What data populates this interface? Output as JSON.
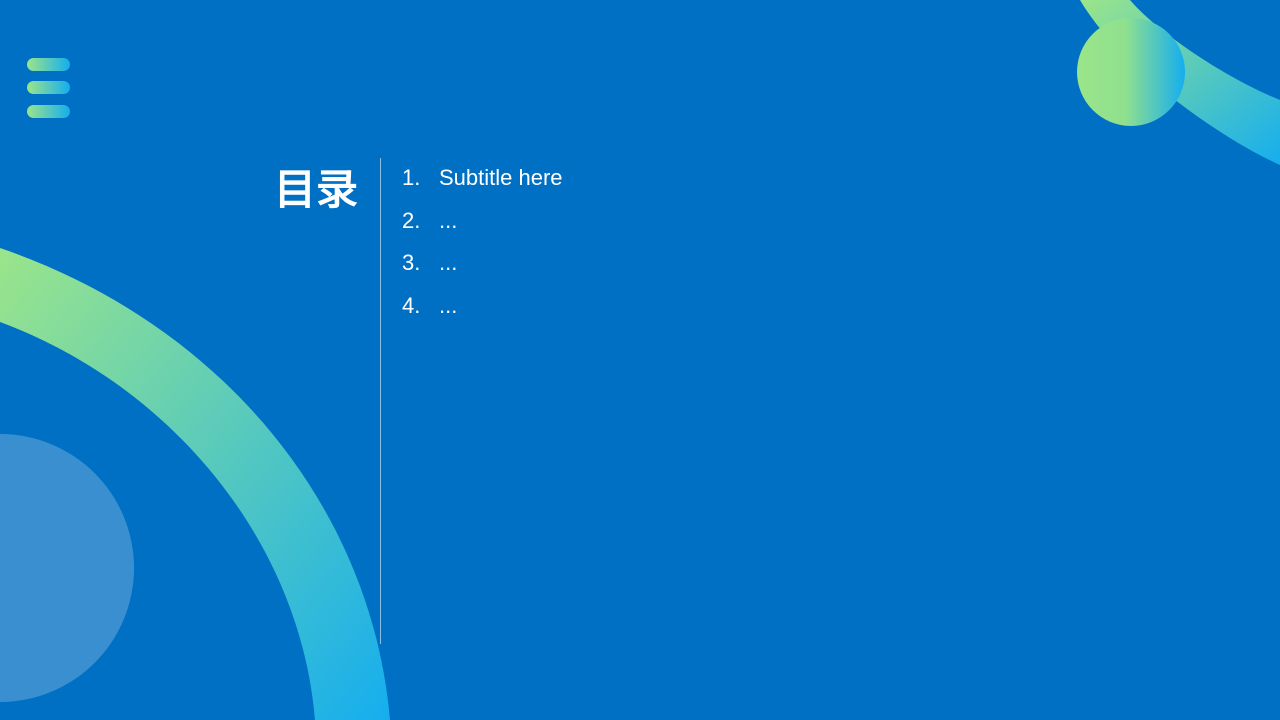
{
  "slide": {
    "background_color": "#0070C4",
    "title": "目录",
    "items": [
      {
        "number": "1.",
        "text": "Subtitle here"
      },
      {
        "number": "2.",
        "text": "..."
      },
      {
        "number": "3.",
        "text": "..."
      },
      {
        "number": "4.",
        "text": "..."
      }
    ]
  },
  "icons": {
    "menu": "hamburger-menu-icon"
  },
  "colors": {
    "gradient_green": "#9BE58A",
    "gradient_blue": "#15AEEF",
    "translucent_circle": "#3A8FD1",
    "text": "#FFFFFF"
  }
}
